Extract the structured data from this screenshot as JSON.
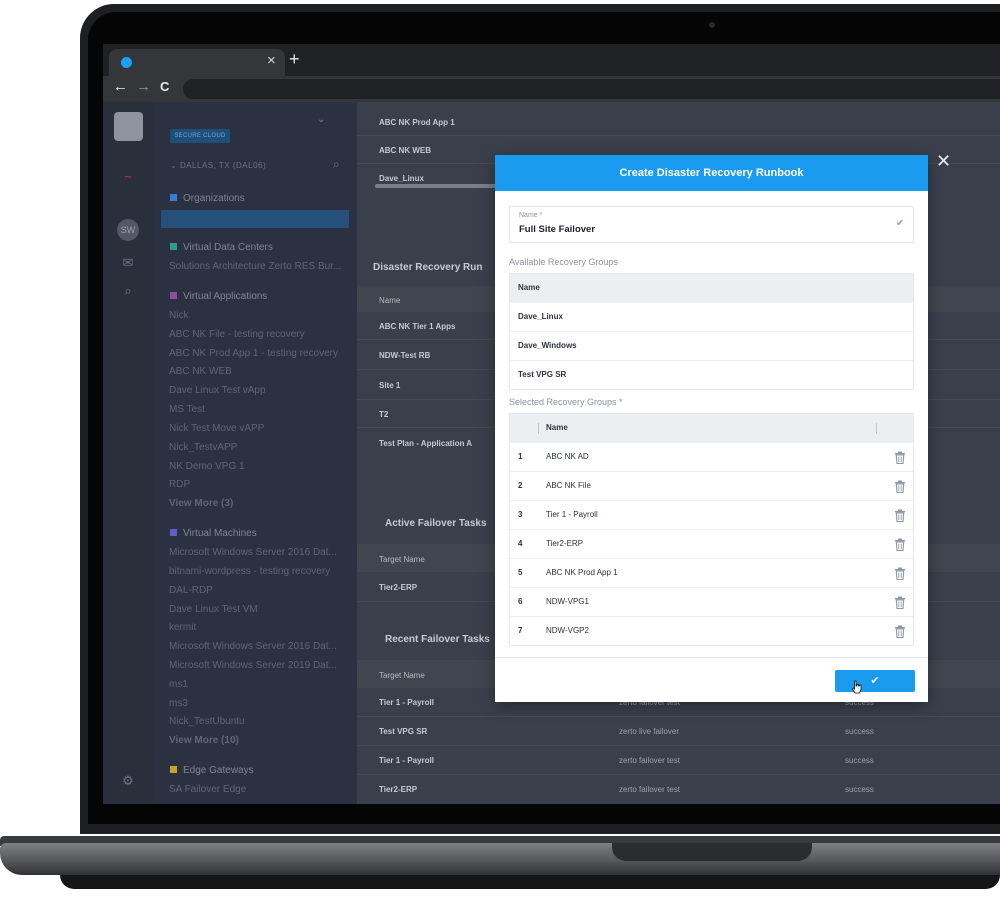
{
  "browser": {
    "tab_close": "×",
    "new_tab": "+",
    "back": "←",
    "forward": "→",
    "reload": "C"
  },
  "rail": {
    "avatar_initials": "SW"
  },
  "sidebar": {
    "site_chip": "SECURE CLOUD",
    "location": "DALLAS, TX (DAL06)",
    "organizations_title": "Organizations",
    "vdc_title": "Virtual Data Centers",
    "vdc_item": "Solutions Architecture Zerto RES Bur...",
    "vapps_title": "Virtual Applications",
    "vapps_items": [
      "Nick",
      "ABC NK File - testing recovery",
      "ABC NK Prod App 1 - testing recovery",
      "ABC NK WEB",
      "Dave Linux Test vApp",
      "MS Test",
      "Nick Test Move vAPP",
      "Nick_TestvAPP",
      "NK Demo VPG 1",
      "RDP"
    ],
    "vapps_more": "View More (3)",
    "vms_title": "Virtual Machines",
    "vms_items": [
      "Microsoft Windows Server 2016 Dat...",
      "bitnami-wordpress - testing recovery",
      "DAL-RDP",
      "Dave Linux Test VM",
      "kermit",
      "Microsoft Windows Server 2016 Dat...",
      "Microsoft Windows Server 2019 Dat...",
      "ms1",
      "ms3",
      "Nick_TestUbuntu"
    ],
    "vms_more": "View More (10)",
    "edge_title": "Edge Gateways",
    "edge_item": "SA Failover Edge"
  },
  "main": {
    "top_rows": [
      "ABC NK Prod App 1",
      "ABC NK WEB",
      "Dave_Linux"
    ],
    "runbooks_title": "Disaster Recovery Run",
    "runbooks_header": "Name",
    "runbooks_rows": [
      "ABC NK Tier 1 Apps",
      "NDW-Test RB",
      "Site 1",
      "T2",
      "Test Plan - Application A"
    ],
    "active_title": "Active Failover Tasks",
    "active_header": "Target Name",
    "active_rows": [
      "Tier2-ERP"
    ],
    "recent_title": "Recent Failover Tasks",
    "recent_header": "Target Name",
    "recent_rows": [
      {
        "target": "Tier 1 - Payroll",
        "plan": "zerto failover test",
        "status": "success"
      },
      {
        "target": "Test VPG SR",
        "plan": "zerto live failover",
        "status": "success"
      },
      {
        "target": "Tier 1 - Payroll",
        "plan": "zerto failover test",
        "status": "success"
      },
      {
        "target": "Tier2-ERP",
        "plan": "zerto failover test",
        "status": "success"
      }
    ]
  },
  "modal": {
    "close": "✕",
    "title": "Create Disaster Recovery Runbook",
    "name_label": "Name *",
    "name_value": "Full Site Failover",
    "available_caption": "Available Recovery Groups",
    "available_header": "Name",
    "available_rows": [
      "Dave_Linux",
      "Dave_Windows",
      "Test VPG SR"
    ],
    "selected_caption": "Selected Recovery Groups *",
    "selected_header": "Name",
    "selected_rows": [
      {
        "index": "1",
        "name": "ABC NK AD"
      },
      {
        "index": "2",
        "name": "ABC NK File"
      },
      {
        "index": "3",
        "name": "Tier 1 - Payroll"
      },
      {
        "index": "4",
        "name": "Tier2-ERP"
      },
      {
        "index": "5",
        "name": "ABC NK Prod App 1"
      },
      {
        "index": "6",
        "name": "NDW-VPG1"
      },
      {
        "index": "7",
        "name": "NDW-VGP2"
      }
    ],
    "confirm_icon": "✔"
  },
  "colors": {
    "accent": "#1a9bef",
    "sidebar_bg": "#2b3140",
    "overlay_bg": "#3a3f4b"
  }
}
